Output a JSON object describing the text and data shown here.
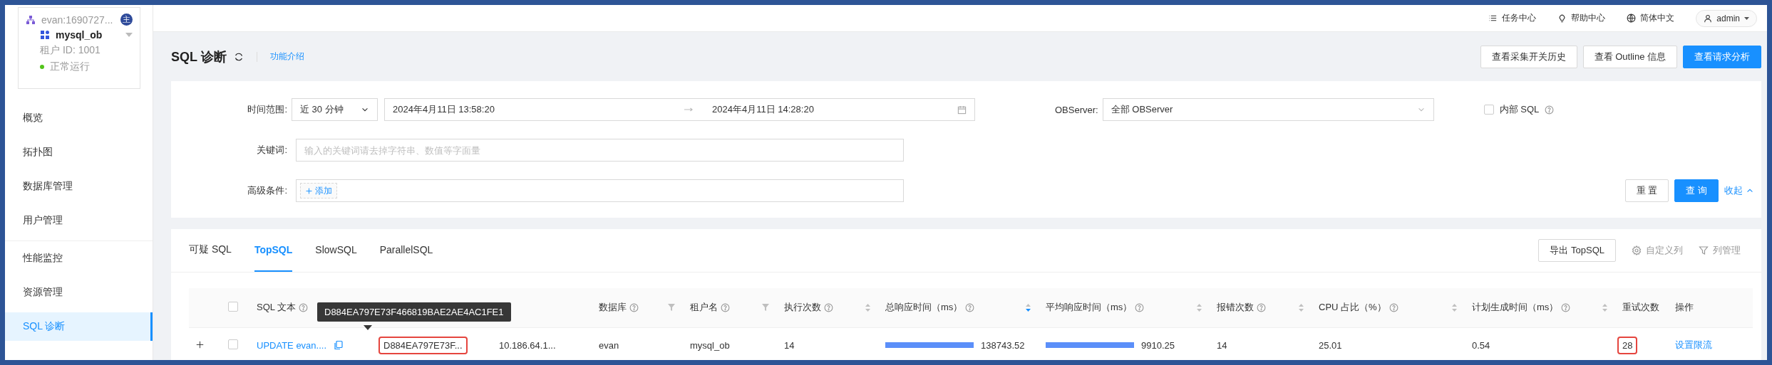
{
  "tenant": {
    "cluster": "evan:1690727...",
    "badge": "主",
    "name": "mysql_ob",
    "id_label": "租户 ID: 1001",
    "status": "正常运行",
    "running": true
  },
  "sidebar": {
    "groups": [
      [
        {
          "label": "概览",
          "selected": false
        },
        {
          "label": "拓扑图",
          "selected": false
        },
        {
          "label": "数据库管理",
          "selected": false
        },
        {
          "label": "用户管理",
          "selected": false
        }
      ],
      [
        {
          "label": "性能监控",
          "selected": false
        },
        {
          "label": "资源管理",
          "selected": false
        },
        {
          "label": "SQL 诊断",
          "selected": true
        }
      ]
    ]
  },
  "topbar": {
    "links": [
      {
        "kind": "tasks",
        "label": "任务中心"
      },
      {
        "kind": "help",
        "label": "帮助中心"
      },
      {
        "kind": "language",
        "label": "简体中文"
      }
    ],
    "user": "admin"
  },
  "page": {
    "title": "SQL 诊断",
    "help_link": "功能介绍",
    "actions": [
      {
        "label": "查看采集开关历史",
        "primary": false
      },
      {
        "label": "查看 Outline 信息",
        "primary": false
      },
      {
        "label": "查看请求分析",
        "primary": true
      }
    ]
  },
  "filters": {
    "time_label": "时间范围:",
    "time_preset": "近 30 分钟",
    "start": "2024年4月11日 13:58:20",
    "end": "2024年4月11日 14:28:20",
    "server_label": "OBServer:",
    "server_value": "全部 OBServer",
    "internal_sql": {
      "label": "内部 SQL",
      "checked": false
    },
    "keyword_label": "关键词:",
    "keyword_placeholder": "输入的关键词请去掉字符串、数值等字面量",
    "advanced_label": "高级条件:",
    "add_button": "添加",
    "reset": "重 置",
    "query": "查 询",
    "collapse": "收起"
  },
  "tabs": [
    {
      "label": "可疑 SQL",
      "selected": false
    },
    {
      "label": "TopSQL",
      "selected": true
    },
    {
      "label": "SlowSQL",
      "selected": false
    },
    {
      "label": "ParallelSQL",
      "selected": false
    }
  ],
  "tab_actions": {
    "export": "导出 TopSQL",
    "custom_columns": "自定义列",
    "column_manager": "列管理"
  },
  "table": {
    "all_checked": false,
    "columns": [
      {
        "label": "SQL 文本",
        "help": true,
        "filterable": false,
        "sortable": false
      },
      {
        "covered": true
      },
      {
        "covered": true
      },
      {
        "label": "数据库",
        "help": true,
        "filterable": true,
        "sortable": false
      },
      {
        "label": "租户名",
        "help": true,
        "filterable": true,
        "sortable": false
      },
      {
        "label": "执行次数",
        "help": true,
        "filterable": false,
        "sortable": true,
        "sorted_desc": false
      },
      {
        "label": "总响应时间（ms）",
        "help": true,
        "filterable": false,
        "sortable": true,
        "sorted_desc": true
      },
      {
        "label": "平均响应时间（ms）",
        "help": true,
        "filterable": false,
        "sortable": true,
        "sorted_desc": false
      },
      {
        "label": "报错次数",
        "help": true,
        "filterable": false,
        "sortable": true,
        "sorted_desc": false
      },
      {
        "label": "CPU 占比（%）",
        "help": true,
        "filterable": false,
        "sortable": true,
        "sorted_desc": false
      },
      {
        "label": "计划生成时间（ms）",
        "help": true,
        "filterable": false,
        "sortable": true,
        "sorted_desc": false
      },
      {
        "label": "重试次数",
        "help": false,
        "filterable": false,
        "sortable": false
      },
      {
        "label": "操作",
        "help": false,
        "filterable": false,
        "sortable": false
      }
    ],
    "rows": [
      {
        "expanded": false,
        "checked": false,
        "cells": [
          {
            "kind": "link",
            "text": "UPDATE evan....",
            "copy": true
          },
          {
            "kind": "text",
            "text": "D884EA797E73F...",
            "highlighted": true,
            "tooltip": "D884EA797E73F466819BAE2AE4AC1FE1"
          },
          {
            "kind": "text",
            "text": "10.186.64.1..."
          },
          {
            "kind": "text",
            "text": "evan"
          },
          {
            "kind": "text",
            "text": "mysql_ob"
          },
          {
            "kind": "text",
            "text": "14"
          },
          {
            "kind": "bar",
            "level": 1,
            "text": "138743.52"
          },
          {
            "kind": "bar",
            "level": 1,
            "text": "9910.25"
          },
          {
            "kind": "text",
            "text": "14"
          },
          {
            "kind": "text",
            "text": "25.01"
          },
          {
            "kind": "text",
            "text": "0.54"
          },
          {
            "kind": "text",
            "text": "28",
            "highlighted": true
          },
          {
            "kind": "link",
            "text": "设置限流"
          }
        ]
      }
    ]
  }
}
